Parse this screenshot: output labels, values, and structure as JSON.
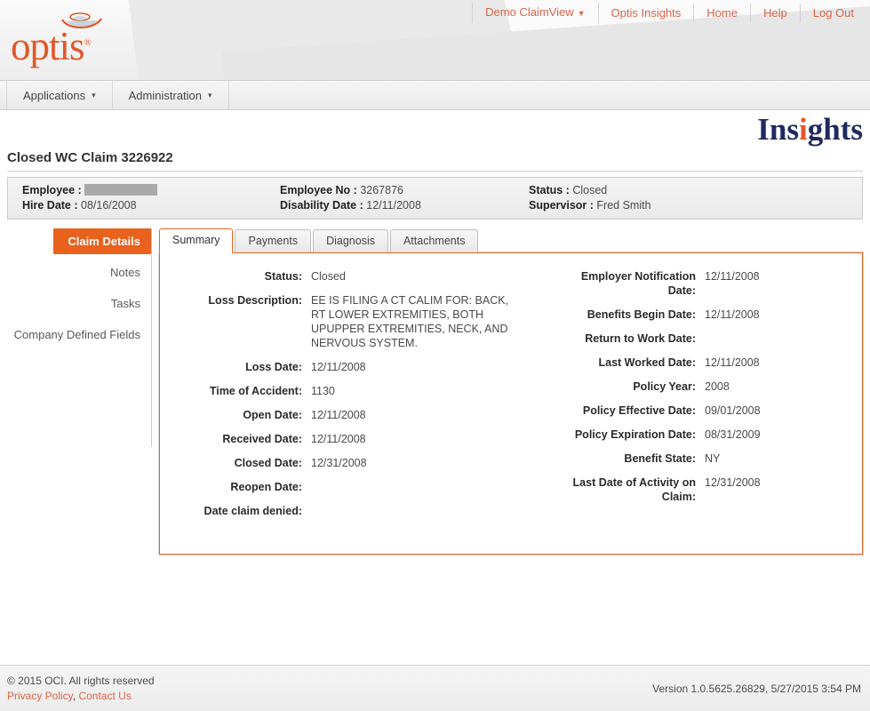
{
  "header": {
    "logo_text": "optis",
    "logo_registered": "®",
    "nav": [
      {
        "label": "Demo ClaimView",
        "has_caret": true,
        "icon": "chevron-down-icon"
      },
      {
        "label": "Optis Insights",
        "has_caret": false
      },
      {
        "label": "Home",
        "has_caret": false
      },
      {
        "label": "Help",
        "has_caret": false
      },
      {
        "label": "Log Out",
        "has_caret": false
      }
    ],
    "brand": {
      "part1": "Ins",
      "part2": "i",
      "part3": "ghts",
      "full": "Insights"
    }
  },
  "menu_bar": {
    "items": [
      {
        "label": "Applications",
        "caret": "▾"
      },
      {
        "label": "Administration",
        "caret": "▾"
      }
    ]
  },
  "page": {
    "title": "Closed WC Claim 3226922"
  },
  "employee_info": {
    "col1": [
      {
        "label": "Employee :",
        "value": "",
        "redacted": true
      },
      {
        "label": "Hire Date :",
        "value": "08/16/2008",
        "redacted": false
      }
    ],
    "col2": [
      {
        "label": "Employee No :",
        "value": "3267876",
        "redacted": false
      },
      {
        "label": "Disability Date :",
        "value": "12/11/2008",
        "redacted": false
      }
    ],
    "col3": [
      {
        "label": "Status :",
        "value": "Closed",
        "redacted": false
      },
      {
        "label": "Supervisor :",
        "value": "Fred Smith",
        "redacted": false
      }
    ]
  },
  "sidebar": {
    "items": [
      {
        "label": "Claim Details",
        "active": true
      },
      {
        "label": "Notes",
        "active": false
      },
      {
        "label": "Tasks",
        "active": false
      },
      {
        "label": "Company Defined Fields",
        "active": false
      }
    ]
  },
  "tabs": [
    {
      "label": "Summary",
      "active": true
    },
    {
      "label": "Payments",
      "active": false
    },
    {
      "label": "Diagnosis",
      "active": false
    },
    {
      "label": "Attachments",
      "active": false
    }
  ],
  "summary": {
    "left_fields": [
      {
        "label": "Status:",
        "value": "Closed"
      },
      {
        "label": "Loss Description:",
        "value": "EE IS FILING A CT CALIM FOR: BACK, RT LOWER EXTREMITIES, BOTH UPUPPER EXTREMITIES, NECK, AND NERVOUS SYSTEM."
      },
      {
        "label": "Loss Date:",
        "value": "12/11/2008"
      },
      {
        "label": "Time of Accident:",
        "value": "1130"
      },
      {
        "label": "Open Date:",
        "value": "12/11/2008"
      },
      {
        "label": "Received Date:",
        "value": "12/11/2008"
      },
      {
        "label": "Closed Date:",
        "value": "12/31/2008"
      },
      {
        "label": "Reopen Date:",
        "value": ""
      },
      {
        "label": "Date claim denied:",
        "value": ""
      }
    ],
    "right_fields": [
      {
        "label": "Employer Notification Date:",
        "value": "12/11/2008"
      },
      {
        "label": "Benefits Begin Date:",
        "value": "12/11/2008"
      },
      {
        "label": "Return to Work Date:",
        "value": ""
      },
      {
        "label": "Last Worked Date:",
        "value": "12/11/2008"
      },
      {
        "label": "Policy Year:",
        "value": "2008"
      },
      {
        "label": "Policy Effective Date:",
        "value": "09/01/2008"
      },
      {
        "label": "Policy Expiration Date:",
        "value": "08/31/2009"
      },
      {
        "label": "Benefit State:",
        "value": "NY"
      },
      {
        "label": "Last Date of Activity on Claim:",
        "value": "12/31/2008"
      }
    ]
  },
  "footer": {
    "copyright": "© 2015 OCI. All rights reserved",
    "links": [
      {
        "label": "Privacy Policy"
      },
      {
        "label": "Contact Us"
      }
    ],
    "link_separator": ", ",
    "version": "Version 1.0.5625.26829, 5/27/2015 3:54 PM"
  },
  "colors": {
    "accent_orange": "#e8621e",
    "link_orange": "#d9654a",
    "brand_navy": "#1f2a5e",
    "logo_orange": "#e1582a"
  }
}
